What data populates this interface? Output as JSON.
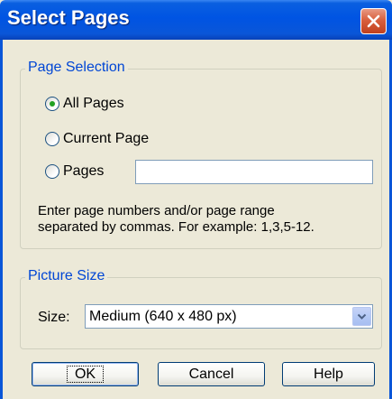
{
  "dialog": {
    "title": "Select Pages"
  },
  "page_selection": {
    "legend": "Page Selection",
    "options": [
      {
        "label": "All Pages",
        "checked": true
      },
      {
        "label": "Current Page",
        "checked": false
      },
      {
        "label": "Pages",
        "checked": false
      }
    ],
    "pages_value": "",
    "hint_line1": "Enter page numbers and/or page range",
    "hint_line2": "separated by commas.  For example: 1,3,5-12."
  },
  "picture_size": {
    "legend": "Picture Size",
    "size_label": "Size:",
    "size_value": "Medium (640 x 480 px)"
  },
  "buttons": {
    "ok": "OK",
    "cancel": "Cancel",
    "help": "Help"
  },
  "colors": {
    "title_bar": "#0054e3",
    "legend_text": "#0046d5",
    "close_button": "#d9603e",
    "dialog_bg": "#ece9d8"
  }
}
